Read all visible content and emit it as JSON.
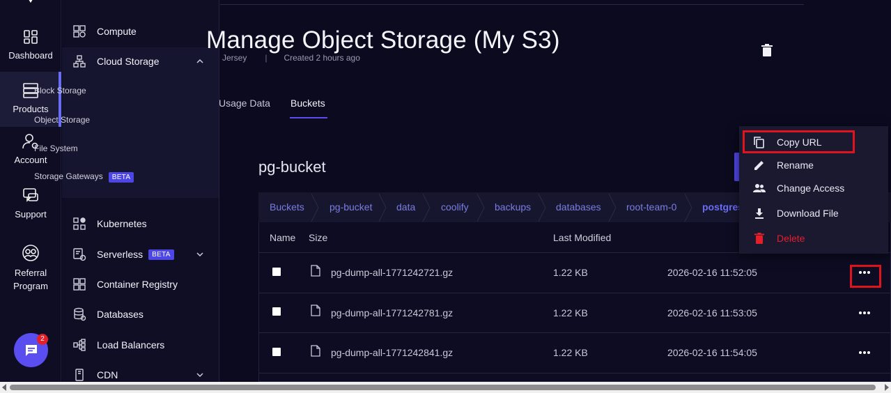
{
  "rail": {
    "items": [
      {
        "label": "Dashboard",
        "icon": "dashboard-icon"
      },
      {
        "label": "Products",
        "icon": "server-stack-icon"
      },
      {
        "label": "Account",
        "icon": "account-gear-icon"
      },
      {
        "label": "Support",
        "icon": "support-chat-icon"
      },
      {
        "label": "Referral",
        "label2": "Program",
        "icon": "referral-icon"
      }
    ],
    "chat_badge": "2"
  },
  "sidebar": {
    "items": [
      {
        "label": "Compute"
      },
      {
        "label": "Cloud Storage"
      },
      {
        "label": "Kubernetes"
      },
      {
        "label": "Serverless",
        "badge": "BETA"
      },
      {
        "label": "Container Registry"
      },
      {
        "label": "Databases"
      },
      {
        "label": "Load Balancers"
      },
      {
        "label": "CDN"
      }
    ],
    "sub_items": [
      {
        "label": "Block Storage"
      },
      {
        "label": "Object Storage"
      },
      {
        "label": "File System"
      },
      {
        "label": "Storage Gateways",
        "badge": "BETA"
      }
    ]
  },
  "page": {
    "title": "Manage Object Storage (My S3)",
    "location": "Jersey",
    "separator": "|",
    "created": "Created 2 hours ago"
  },
  "tabs": [
    {
      "label": "Usage Data"
    },
    {
      "label": "Buckets"
    }
  ],
  "bucket": {
    "name": "pg-bucket",
    "breadcrumbs": [
      "Buckets",
      "pg-bucket",
      "data",
      "coolify",
      "backups",
      "databases",
      "root-team-0",
      "postgres"
    ],
    "columns": {
      "name": "Name",
      "size": "Size",
      "last_modified": "Last Modified"
    },
    "rows": [
      {
        "file": "pg-dump-all-1771242721.gz",
        "size": "1.22 KB",
        "modified": "2026-02-16 11:52:05"
      },
      {
        "file": "pg-dump-all-1771242781.gz",
        "size": "1.22 KB",
        "modified": "2026-02-16 11:53:05"
      },
      {
        "file": "pg-dump-all-1771242841.gz",
        "size": "1.22 KB",
        "modified": "2026-02-16 11:54:05"
      }
    ]
  },
  "menu": {
    "items": [
      {
        "label": "Copy URL",
        "icon": "copy-icon"
      },
      {
        "label": "Rename",
        "icon": "pencil-icon"
      },
      {
        "label": "Change Access",
        "icon": "users-icon"
      },
      {
        "label": "Download File",
        "icon": "download-icon"
      },
      {
        "label": "Delete",
        "icon": "trash-icon"
      }
    ]
  },
  "colors": {
    "background": "#0b0a1f",
    "accent": "#5b4ef0",
    "danger": "#e61e2a",
    "highlight_box": "#e0141c"
  }
}
